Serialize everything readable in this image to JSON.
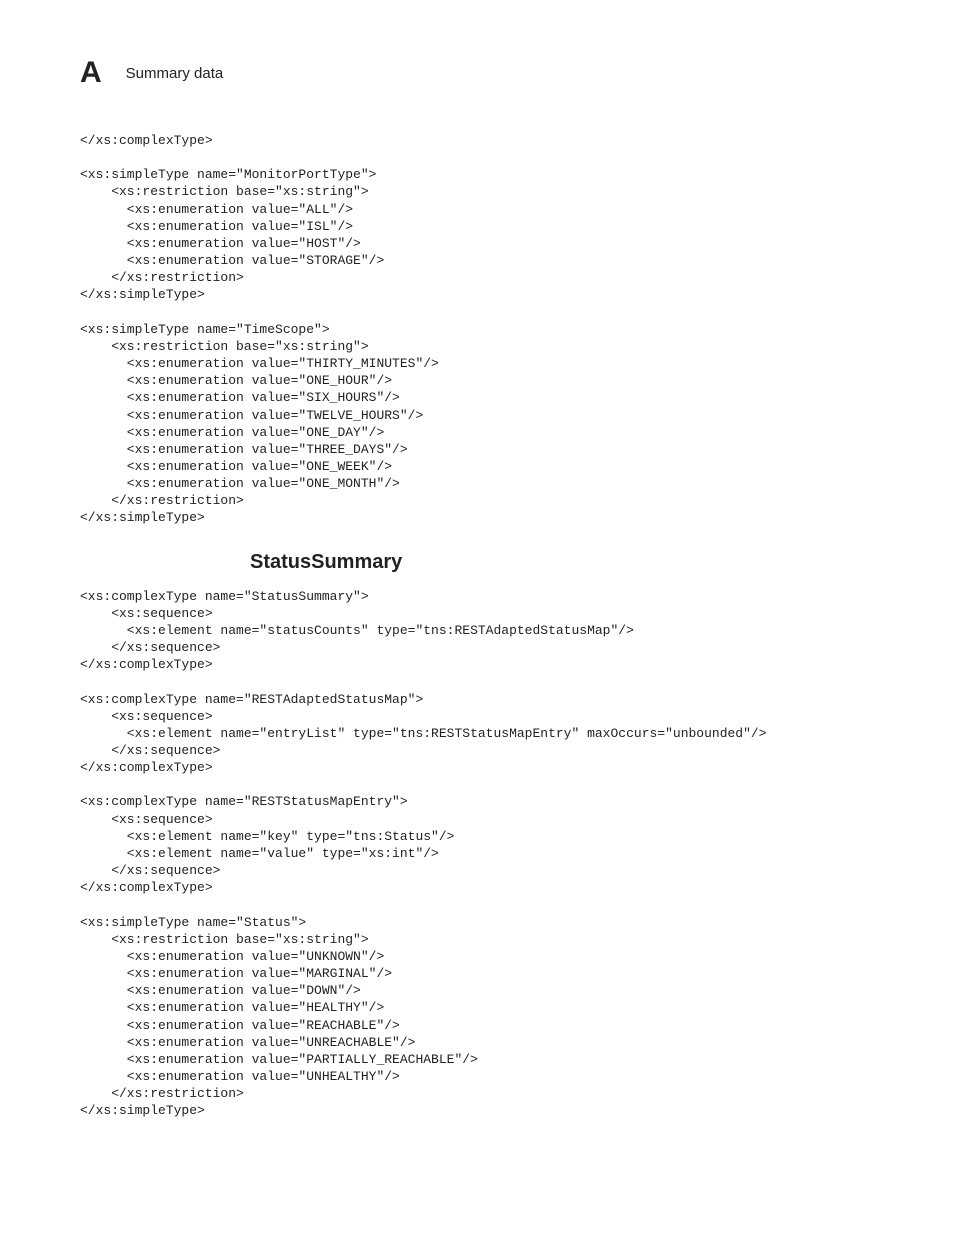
{
  "header": {
    "letter": "A",
    "title": "Summary data"
  },
  "code1": "</xs:complexType>\n\n<xs:simpleType name=\"MonitorPortType\">\n    <xs:restriction base=\"xs:string\">\n      <xs:enumeration value=\"ALL\"/>\n      <xs:enumeration value=\"ISL\"/>\n      <xs:enumeration value=\"HOST\"/>\n      <xs:enumeration value=\"STORAGE\"/>\n    </xs:restriction>\n</xs:simpleType>\n\n<xs:simpleType name=\"TimeScope\">\n    <xs:restriction base=\"xs:string\">\n      <xs:enumeration value=\"THIRTY_MINUTES\"/>\n      <xs:enumeration value=\"ONE_HOUR\"/>\n      <xs:enumeration value=\"SIX_HOURS\"/>\n      <xs:enumeration value=\"TWELVE_HOURS\"/>\n      <xs:enumeration value=\"ONE_DAY\"/>\n      <xs:enumeration value=\"THREE_DAYS\"/>\n      <xs:enumeration value=\"ONE_WEEK\"/>\n      <xs:enumeration value=\"ONE_MONTH\"/>\n    </xs:restriction>\n</xs:simpleType>",
  "section_heading": "StatusSummary",
  "code2": "<xs:complexType name=\"StatusSummary\">\n    <xs:sequence>\n      <xs:element name=\"statusCounts\" type=\"tns:RESTAdaptedStatusMap\"/>\n    </xs:sequence>\n</xs:complexType>\n\n<xs:complexType name=\"RESTAdaptedStatusMap\">\n    <xs:sequence>\n      <xs:element name=\"entryList\" type=\"tns:RESTStatusMapEntry\" maxOccurs=\"unbounded\"/>\n    </xs:sequence>\n</xs:complexType>\n\n<xs:complexType name=\"RESTStatusMapEntry\">\n    <xs:sequence>\n      <xs:element name=\"key\" type=\"tns:Status\"/>\n      <xs:element name=\"value\" type=\"xs:int\"/>\n    </xs:sequence>\n</xs:complexType>\n\n<xs:simpleType name=\"Status\">\n    <xs:restriction base=\"xs:string\">\n      <xs:enumeration value=\"UNKNOWN\"/>\n      <xs:enumeration value=\"MARGINAL\"/>\n      <xs:enumeration value=\"DOWN\"/>\n      <xs:enumeration value=\"HEALTHY\"/>\n      <xs:enumeration value=\"REACHABLE\"/>\n      <xs:enumeration value=\"UNREACHABLE\"/>\n      <xs:enumeration value=\"PARTIALLY_REACHABLE\"/>\n      <xs:enumeration value=\"UNHEALTHY\"/>\n    </xs:restriction>\n</xs:simpleType>"
}
